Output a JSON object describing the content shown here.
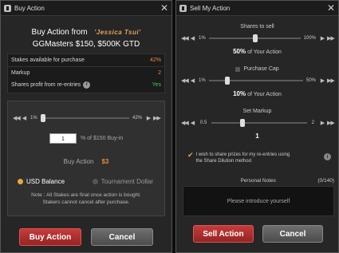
{
  "buy": {
    "window_title": "Buy Action",
    "header_prefix": "Buy Action from",
    "player_name": "'Jessica Tsui'",
    "tournament": "GGMasters $150, $500K GTD",
    "stakes": {
      "available_label": "Stakes available for purchase",
      "available_value": "42%",
      "markup_label": "Markup",
      "markup_value": "2",
      "share_label": "Shares profit from re-entries",
      "share_value": "Yes"
    },
    "slider": {
      "min": "1%",
      "max": "42%",
      "value_fraction": 0.0
    },
    "buyin": {
      "value": "1",
      "suffix": "% of $150 Buy-in"
    },
    "buy_action": {
      "label": "Buy Action",
      "amount": "$3"
    },
    "currency": {
      "usd_label": "USD Balance",
      "td_label": "Tournament Dollar"
    },
    "note_line1": "Note : All Stakes are final once action is bought.",
    "note_line2": "Stakers cannot cancel after purchase.",
    "buy_button": "Buy Action",
    "cancel_button": "Cancel"
  },
  "sell": {
    "window_title": "Sell My Action",
    "shares_label": "Shares to sell",
    "shares_min": "1%",
    "shares_max": "100%",
    "shares_value": "50%",
    "shares_suffix": " of Your Action",
    "purchase_cap_label": "Purchase Cap",
    "cap_min": "1%",
    "cap_max": "50%",
    "cap_value": "10%",
    "cap_suffix": " of Your Action",
    "markup_label": "Set Markup",
    "markup_min": "0.5",
    "markup_max": "2",
    "markup_value": "1",
    "dilution_line1": "I wish to share prizes for my re-entries using",
    "dilution_line2": "the Share Dilution method",
    "notes_label": "Personal Notes",
    "notes_count": "(0/140)",
    "notes_placeholder": "Please introduce yourself",
    "sell_button": "Sell Action",
    "cancel_button": "Cancel"
  },
  "colors": {
    "accent_orange": "#e58a3c",
    "green": "#3cc85a",
    "red_button": "#c63b3b"
  },
  "icons": [
    "close-icon",
    "info-icon",
    "double-left-arrow-icon",
    "left-arrow-icon",
    "right-arrow-icon",
    "double-right-arrow-icon",
    "checkmark-icon"
  ]
}
